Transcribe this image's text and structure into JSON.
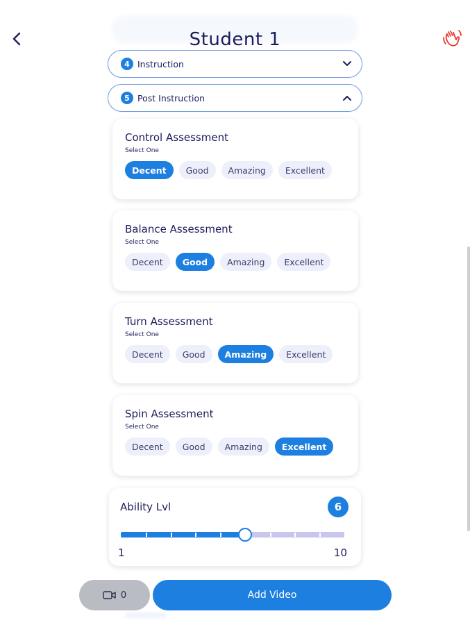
{
  "header": {
    "title": "Student 1"
  },
  "sections": [
    {
      "number": "4",
      "label": "Instruction",
      "expanded": false
    },
    {
      "number": "5",
      "label": "Post Instruction",
      "expanded": true
    }
  ],
  "assessments": [
    {
      "title": "Control Assessment",
      "subtitle": "Select One",
      "options": [
        "Decent",
        "Good",
        "Amazing",
        "Excellent"
      ],
      "selected": "Decent"
    },
    {
      "title": "Balance Assessment",
      "subtitle": "Select One",
      "options": [
        "Decent",
        "Good",
        "Amazing",
        "Excellent"
      ],
      "selected": "Good"
    },
    {
      "title": "Turn Assessment",
      "subtitle": "Select One",
      "options": [
        "Decent",
        "Good",
        "Amazing",
        "Excellent"
      ],
      "selected": "Amazing"
    },
    {
      "title": "Spin Assessment",
      "subtitle": "Select One",
      "options": [
        "Decent",
        "Good",
        "Amazing",
        "Excellent"
      ],
      "selected": "Excellent"
    }
  ],
  "ability": {
    "label": "Ability Lvl",
    "value": "6",
    "min": "1",
    "max": "10",
    "level": 6
  },
  "footer": {
    "video_count": "0",
    "add_video_label": "Add Video"
  },
  "colors": {
    "accent": "#1d7fe0",
    "text": "#1c1c5c",
    "chip_bg": "#edf0fa",
    "track_rest": "#c9c6ee",
    "wave_icon": "#e8382e"
  },
  "icons": {
    "back": "chevron-left-icon",
    "wave": "waving-hand-icon",
    "camera": "video-camera-icon"
  }
}
